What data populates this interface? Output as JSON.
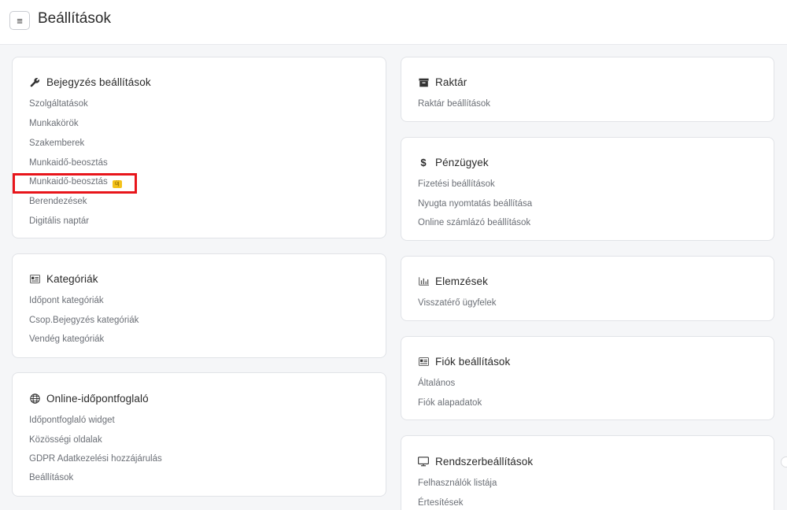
{
  "header": {
    "menu_icon": "≡",
    "title": "Beállítások"
  },
  "cards": {
    "bejegyzes": {
      "title": "Bejegyzés beállítások",
      "icon": "wrench-icon",
      "items": [
        "Szolgáltatások",
        "Munkakörök",
        "Szakemberek",
        "Munkaidő-beosztás",
        "Munkaidő-beosztás",
        "Berendezések",
        "Digitális naptár"
      ],
      "new_badge": "új"
    },
    "kategoriak": {
      "title": "Kategóriák",
      "icon": "id-card-icon",
      "items": [
        "Időpont kategóriák",
        "Csop.Bejegyzés kategóriák",
        "Vendég kategóriák"
      ]
    },
    "online": {
      "title": "Online-időpontfoglaló",
      "icon": "globe-icon",
      "items": [
        "Időpontfoglaló widget",
        "Közösségi oldalak",
        "GDPR Adatkezelési hozzájárulás",
        "Beállítások"
      ]
    },
    "raktar": {
      "title": "Raktár",
      "icon": "archive-icon",
      "items": [
        "Raktár beállítások"
      ]
    },
    "penzugyek": {
      "title": "Pénzügyek",
      "icon": "dollar-icon",
      "items": [
        "Fizetési beállítások",
        "Nyugta nyomtatás beállítása",
        "Online számlázó beállítások"
      ]
    },
    "elemzesek": {
      "title": "Elemzések",
      "icon": "chart-icon",
      "items": [
        "Visszatérő ügyfelek"
      ]
    },
    "fiok": {
      "title": "Fiók beállítások",
      "icon": "id-card-icon",
      "items": [
        "Általános",
        "Fiók alapadatok"
      ]
    },
    "rendszer": {
      "title": "Rendszerbeállítások",
      "icon": "monitor-icon",
      "items": [
        "Felhasználók listája",
        "Értesítések"
      ]
    }
  },
  "colors": {
    "highlight": "#e8151b",
    "badge": "#f4c21a"
  }
}
